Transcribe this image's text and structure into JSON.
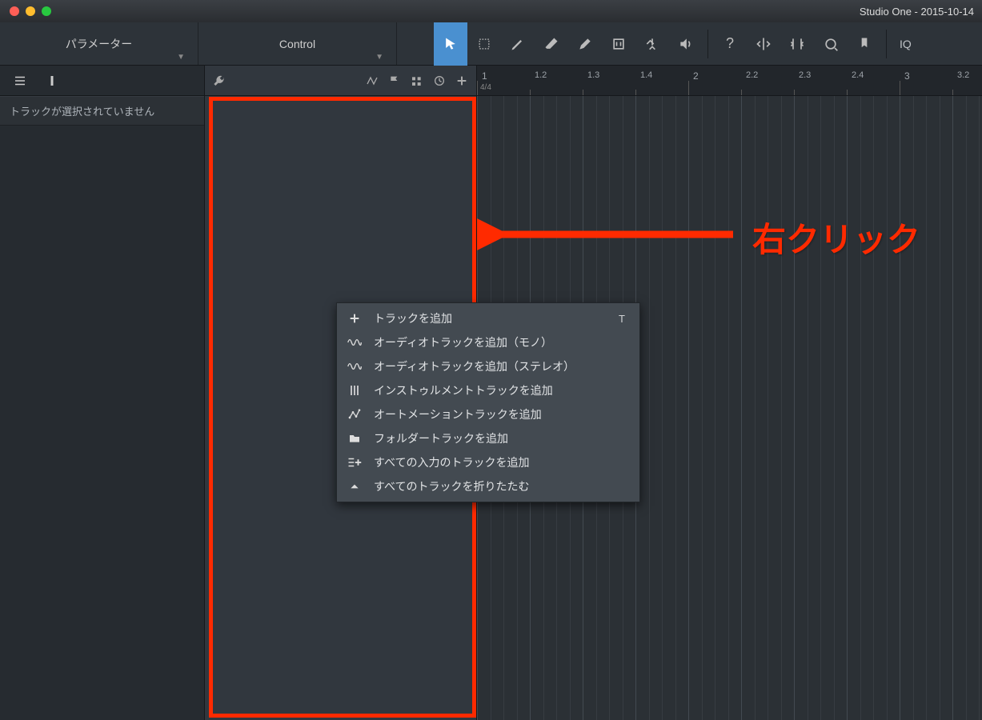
{
  "titlebar": {
    "title": "Studio One - 2015-10-14"
  },
  "tabs": [
    {
      "label": "パラメーター"
    },
    {
      "label": "Control"
    }
  ],
  "tool_icons": {
    "arrow": "arrow-tool",
    "range": "range-tool",
    "draw": "draw-tool",
    "erase": "erase-tool",
    "paint": "paint-tool",
    "mute": "mute-tool",
    "bend": "bend-tool",
    "listen": "listen-tool",
    "help": "?",
    "iq": "IQ"
  },
  "left_panel": {
    "status": "トラックが選択されていません"
  },
  "ruler": {
    "time_signature": "4/4",
    "marks": [
      {
        "label": "1",
        "pos": 0,
        "main": true
      },
      {
        "label": "1.2",
        "pos": 66
      },
      {
        "label": "1.3",
        "pos": 132
      },
      {
        "label": "1.4",
        "pos": 198
      },
      {
        "label": "2",
        "pos": 264,
        "main": true
      },
      {
        "label": "2.2",
        "pos": 330
      },
      {
        "label": "2.3",
        "pos": 396
      },
      {
        "label": "2.4",
        "pos": 462
      },
      {
        "label": "3",
        "pos": 528,
        "main": true
      },
      {
        "label": "3.2",
        "pos": 594
      }
    ]
  },
  "context_menu": {
    "items": [
      {
        "icon": "plus",
        "label": "トラックを追加",
        "shortcut": "T"
      },
      {
        "icon": "wave",
        "label": "オーディオトラックを追加（モノ）"
      },
      {
        "icon": "wave",
        "label": "オーディオトラックを追加（ステレオ）"
      },
      {
        "icon": "sliders",
        "label": "インストゥルメントトラックを追加"
      },
      {
        "icon": "automation",
        "label": "オートメーショントラックを追加"
      },
      {
        "icon": "folder",
        "label": "フォルダートラックを追加"
      },
      {
        "icon": "list-plus",
        "label": "すべての入力のトラックを追加"
      },
      {
        "icon": "collapse",
        "label": "すべてのトラックを折りたたむ"
      }
    ]
  },
  "annotation": {
    "text": "右クリック"
  }
}
